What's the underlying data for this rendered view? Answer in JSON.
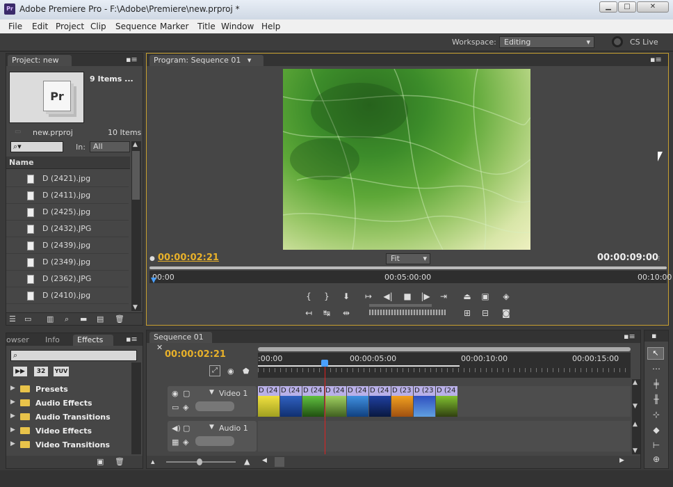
{
  "window": {
    "title": "Adobe Premiere Pro - F:\\Adobe\\Premiere\\new.prproj *",
    "icon_text": "Pr"
  },
  "menu": [
    "File",
    "Edit",
    "Project",
    "Clip",
    "Sequence",
    "Marker",
    "Title",
    "Window",
    "Help"
  ],
  "workspace": {
    "label": "Workspace:",
    "value": "Editing",
    "cs_live": "CS Live"
  },
  "project": {
    "tab": "Project: new",
    "items_label": "9 Items ...",
    "filename": "new.prproj",
    "count": "10 Items",
    "in_label": "In:",
    "in_value": "All",
    "column_name": "Name",
    "files": [
      "D (2421).jpg",
      "D (2411).jpg",
      "D (2425).jpg",
      "D (2432).JPG",
      "D (2439).jpg",
      "D (2349).jpg",
      "D (2362).JPG",
      "D (2410).jpg"
    ]
  },
  "program": {
    "tab": "Program: Sequence 01",
    "current_time": "00:00:02:21",
    "duration": "00:00:09:00",
    "fit": "Fit",
    "ruler": [
      "00:00",
      "00:05:00:00",
      "00:10:00"
    ]
  },
  "effects": {
    "tabs": [
      "owser",
      "Info",
      "Effects"
    ],
    "badges": [
      "32",
      "YUV"
    ],
    "bins": [
      "Presets",
      "Audio Effects",
      "Audio Transitions",
      "Video Effects",
      "Video Transitions"
    ]
  },
  "timeline": {
    "tab": "Sequence 01",
    "current_time": "00:00:02:21",
    "ruler": [
      ":00:00",
      "00:00:05:00",
      "00:00:10:00",
      "00:00:15:00"
    ],
    "video_track": "Video 1",
    "audio_track": "Audio 1",
    "clip_label": "D (24",
    "clip_label_alt": "D (23",
    "playhead_fraction": 0.33
  },
  "colors": {
    "accent_timecode": "#e8b12a",
    "playhead": "#e02020",
    "clip_label": "#b9b0e8"
  }
}
